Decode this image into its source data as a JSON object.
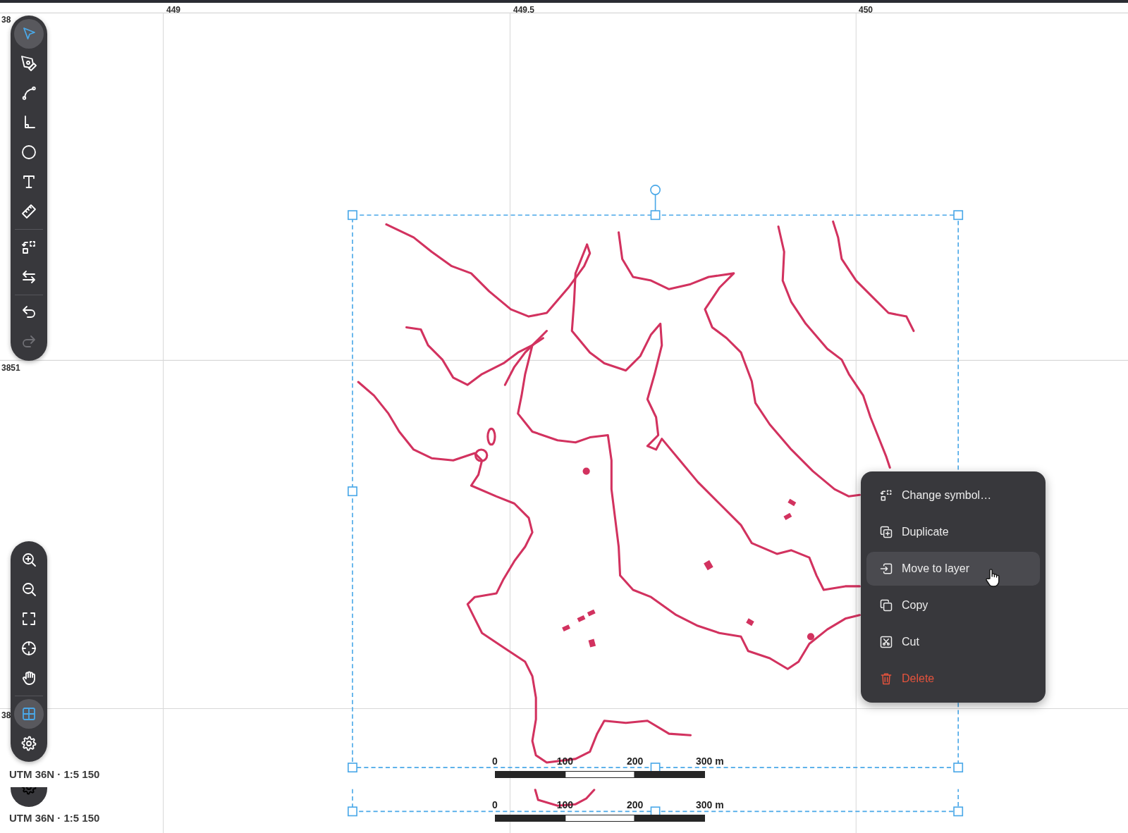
{
  "axis": {
    "x_labels": [
      "449",
      "449.5",
      "450"
    ],
    "y_labels": [
      "38",
      "3851",
      "38"
    ]
  },
  "toolbar": {
    "groups": [
      [
        {
          "selected": true,
          "disabled": false
        },
        {
          "selected": false,
          "disabled": false
        },
        {
          "selected": false,
          "disabled": false
        },
        {
          "selected": false,
          "disabled": false
        },
        {
          "selected": false,
          "disabled": false
        },
        {
          "selected": false,
          "disabled": false
        },
        {
          "selected": false,
          "disabled": false
        }
      ],
      [
        {
          "selected": false,
          "disabled": false
        },
        {
          "selected": false,
          "disabled": false
        }
      ],
      [
        {
          "selected": false,
          "disabled": false
        },
        {
          "selected": false,
          "disabled": true
        }
      ]
    ]
  },
  "view_toolbar": {
    "groups": [
      [
        {
          "selected": false
        },
        {
          "selected": false
        },
        {
          "selected": false
        },
        {
          "selected": false
        },
        {
          "selected": false
        }
      ],
      [
        {
          "selected": true
        },
        {
          "selected": false
        }
      ]
    ]
  },
  "status": "UTM 36N · 1:5 150",
  "scale_bar": {
    "labels": [
      "0",
      "100",
      "200",
      "300 m"
    ]
  },
  "context_menu": {
    "items": [
      {
        "label": "Change symbol…",
        "hovered": false,
        "kind": "normal"
      },
      {
        "label": "Duplicate",
        "hovered": false,
        "kind": "normal"
      },
      {
        "label": "Move to layer",
        "hovered": true,
        "kind": "normal"
      },
      {
        "label": "Copy",
        "hovered": false,
        "kind": "normal"
      },
      {
        "label": "Cut",
        "hovered": false,
        "kind": "normal"
      },
      {
        "label": "Delete",
        "hovered": false,
        "kind": "danger"
      }
    ]
  },
  "repeated_strip": {
    "status": "UTM 36N · 1:5 150",
    "scale_labels": [
      "0",
      "100",
      "200",
      "300 m"
    ]
  }
}
